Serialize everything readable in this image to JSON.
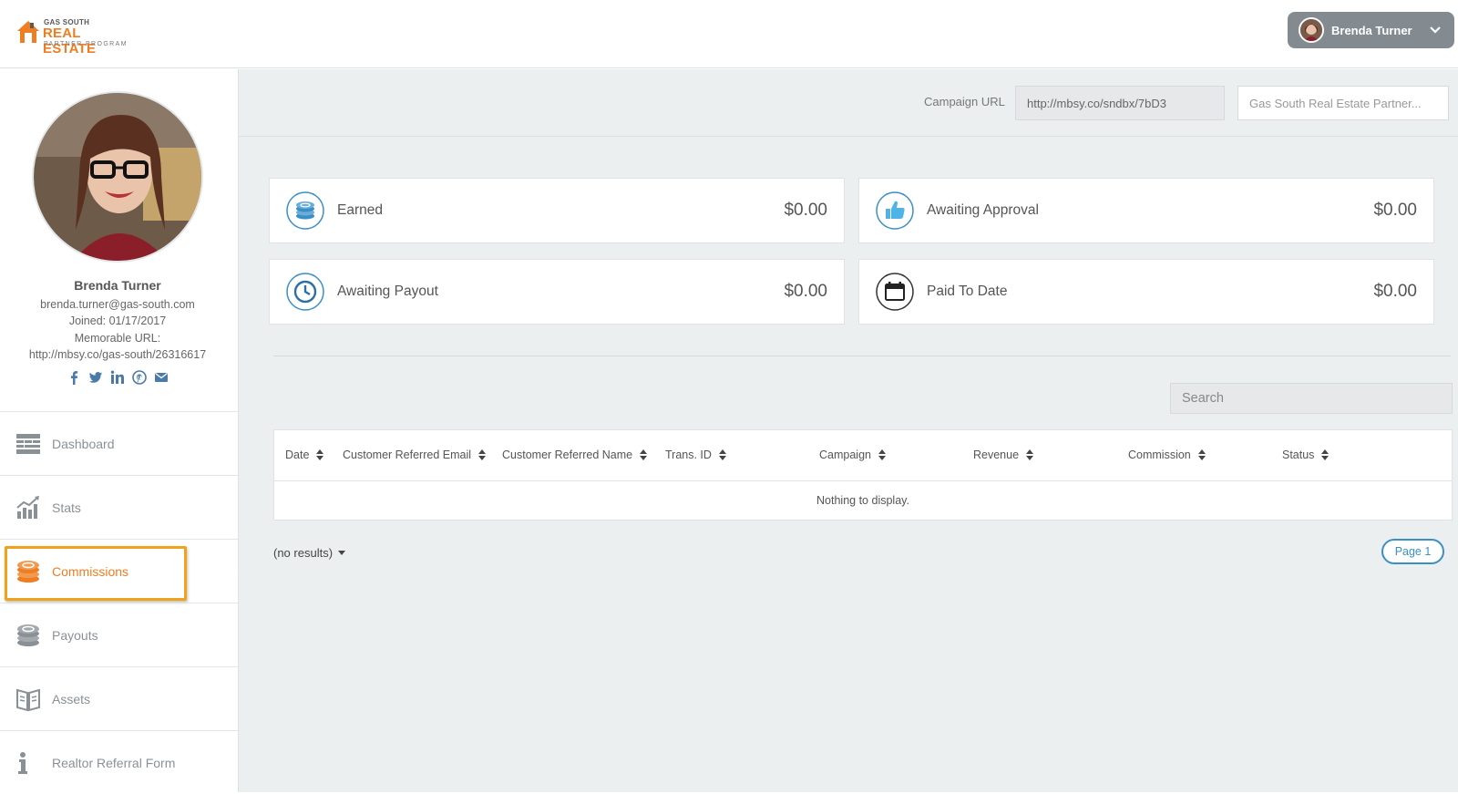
{
  "brand": {
    "logo_line1": "GAS SOUTH",
    "logo_line2": "REAL ESTATE",
    "logo_line3": "PARTNER PROGRAM",
    "accent": "#ef7d22",
    "link_blue": "#3b8fc7",
    "highlight": "#f0a31a"
  },
  "header": {
    "user_name": "Brenda Turner",
    "menu_icon": "chevron-down-icon"
  },
  "profile": {
    "name": "Brenda Turner",
    "email": "brenda.turner@gas-south.com",
    "joined": "Joined: 01/17/2017",
    "memorable_label": "Memorable URL:",
    "memorable_url": "http://mbsy.co/gas-south/26316617",
    "socials": [
      "facebook-icon",
      "twitter-icon",
      "linkedin-icon",
      "pinterest-icon",
      "email-icon"
    ]
  },
  "nav": {
    "items": [
      {
        "label": "Dashboard",
        "icon": "dashboard-icon"
      },
      {
        "label": "Stats",
        "icon": "stats-icon"
      },
      {
        "label": "Commissions",
        "icon": "commissions-icon",
        "active": true
      },
      {
        "label": "Payouts",
        "icon": "payouts-icon"
      },
      {
        "label": "Assets",
        "icon": "assets-icon"
      },
      {
        "label": "Realtor Referral Form",
        "icon": "info-icon"
      }
    ]
  },
  "campaign": {
    "url_label": "Campaign URL",
    "url_value": "http://mbsy.co/sndbx/7bD3",
    "selected": "Gas South Real Estate Partner..."
  },
  "cards": [
    {
      "label": "Earned",
      "value": "$0.00",
      "icon": "coins-icon"
    },
    {
      "label": "Awaiting Approval",
      "value": "$0.00",
      "icon": "thumbs-up-icon"
    },
    {
      "label": "Awaiting Payout",
      "value": "$0.00",
      "icon": "clock-icon"
    },
    {
      "label": "Paid To Date",
      "value": "$0.00",
      "icon": "calendar-icon"
    }
  ],
  "search": {
    "placeholder": "Search"
  },
  "table": {
    "columns": [
      "Date",
      "Customer Referred Email",
      "Customer Referred Name",
      "Trans. ID",
      "Campaign",
      "Revenue",
      "Commission",
      "Status"
    ],
    "empty_text": "Nothing to display."
  },
  "pagination": {
    "results_label": "(no results)",
    "page_label": "Page 1"
  }
}
